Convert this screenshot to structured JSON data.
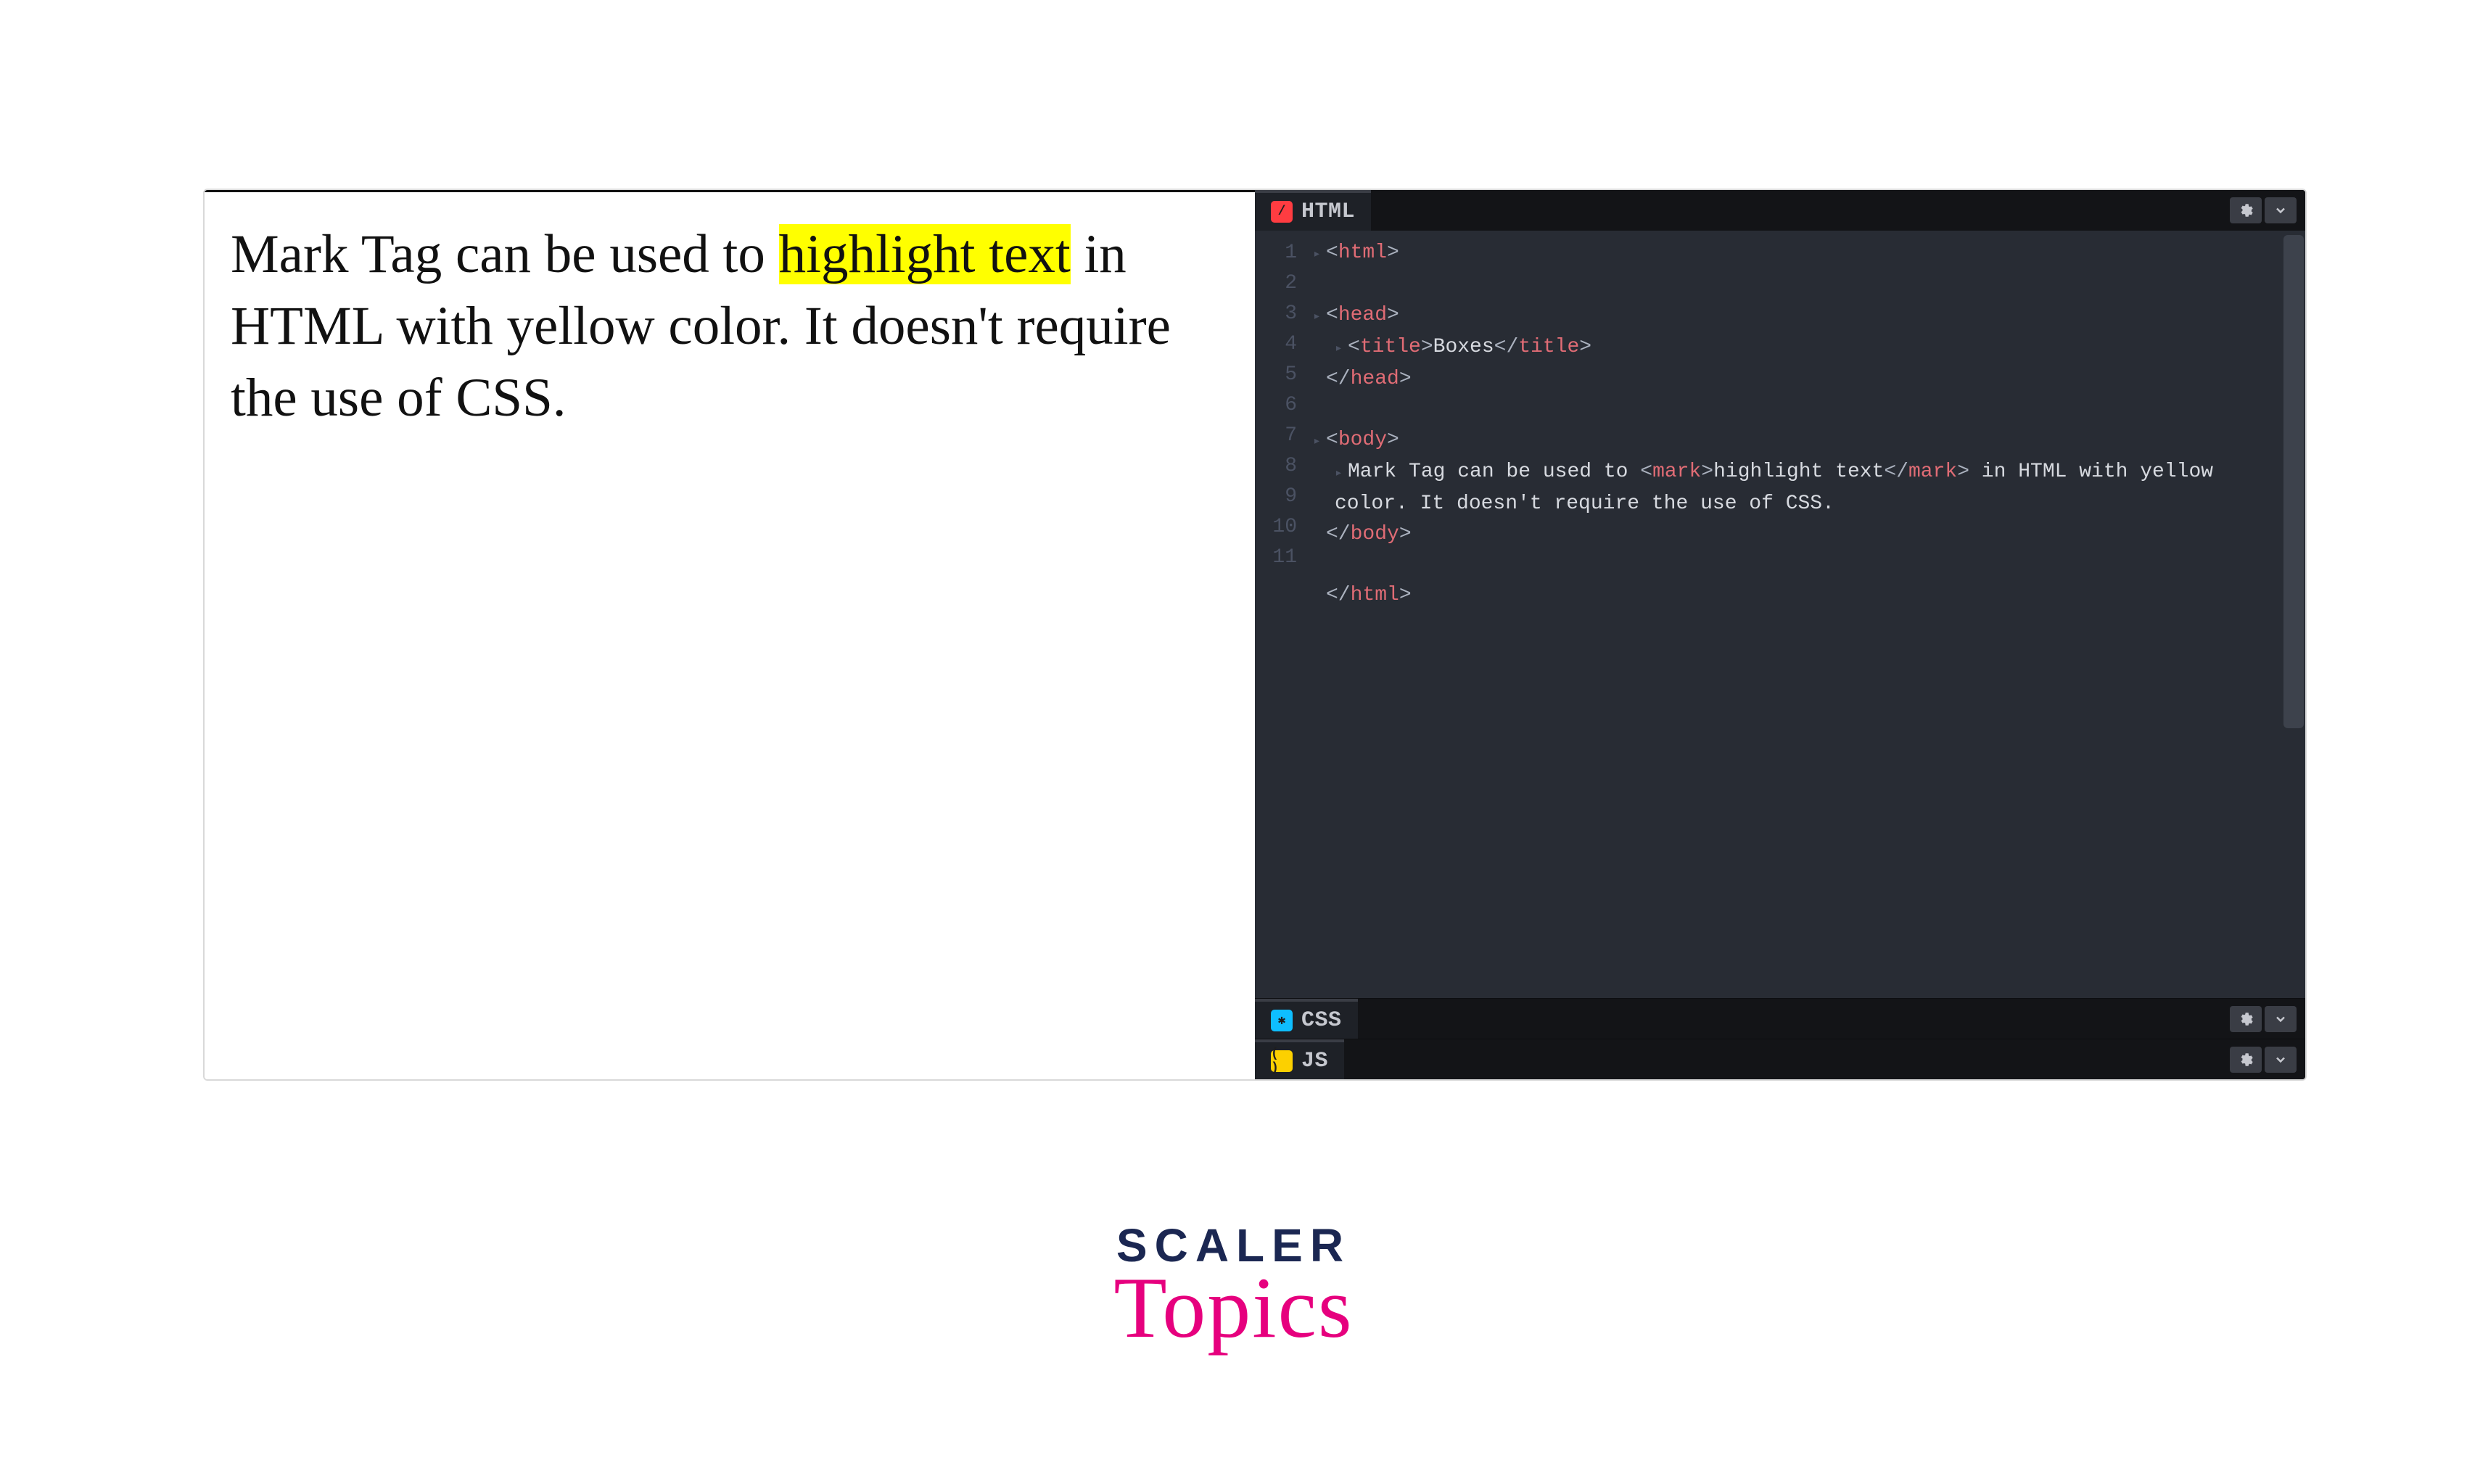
{
  "preview": {
    "before": "Mark Tag can be used to ",
    "highlight": "highlight text",
    "after": " in HTML with yellow color. It doesn't require the use of CSS."
  },
  "panels": {
    "html": {
      "label": "HTML"
    },
    "css": {
      "label": "CSS"
    },
    "js": {
      "label": "JS"
    }
  },
  "code": {
    "line_numbers": [
      "1",
      "2",
      "3",
      "4",
      "5",
      "6",
      "7",
      "8",
      "",
      "9",
      "10",
      "11"
    ],
    "lines": [
      {
        "type": "tag-open",
        "indent": 0,
        "fold": true,
        "name": "html"
      },
      {
        "type": "blank",
        "indent": 0
      },
      {
        "type": "tag-open",
        "indent": 0,
        "fold": true,
        "name": "head"
      },
      {
        "type": "title",
        "indent": 1,
        "fold": true,
        "text": "Boxes"
      },
      {
        "type": "tag-close",
        "indent": 0,
        "name": "head"
      },
      {
        "type": "blank",
        "indent": 0
      },
      {
        "type": "tag-open",
        "indent": 0,
        "fold": true,
        "name": "body"
      },
      {
        "type": "body-text",
        "indent": 1,
        "fold": true,
        "before": "Mark Tag can be used to ",
        "mark": "highlight text",
        "after": " in HTML with yellow color. It doesn't require the use of CSS."
      },
      {
        "type": "tag-close",
        "indent": 0,
        "name": "body"
      },
      {
        "type": "blank",
        "indent": 0
      },
      {
        "type": "tag-close",
        "indent": 0,
        "name": "html"
      }
    ]
  },
  "brand": {
    "top": "SCALER",
    "bottom": "Topics"
  }
}
